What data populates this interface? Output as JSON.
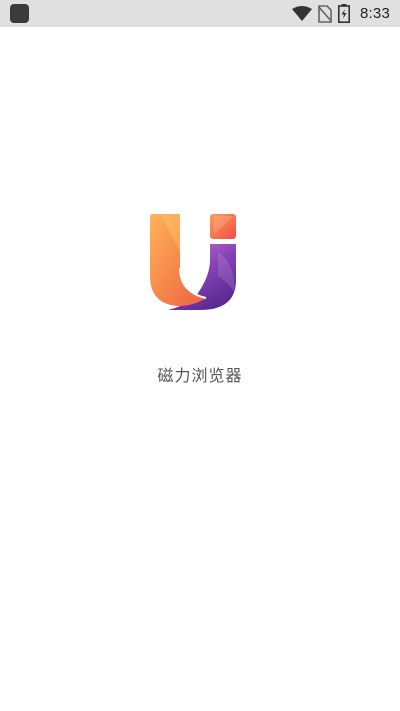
{
  "status_bar": {
    "time": "8:33",
    "icons": [
      "app-notification-icon",
      "wifi-icon",
      "no-sim-icon",
      "battery-charging-icon"
    ]
  },
  "splash": {
    "app_name": "磁力浏览器",
    "logo_icon": "ui-logo-icon"
  },
  "colors": {
    "status_bar_bg": "#e0e0e0",
    "background": "#ffffff",
    "logo_orange": "#f7874a",
    "logo_purple": "#6b34a3",
    "title_text": "#555555"
  }
}
